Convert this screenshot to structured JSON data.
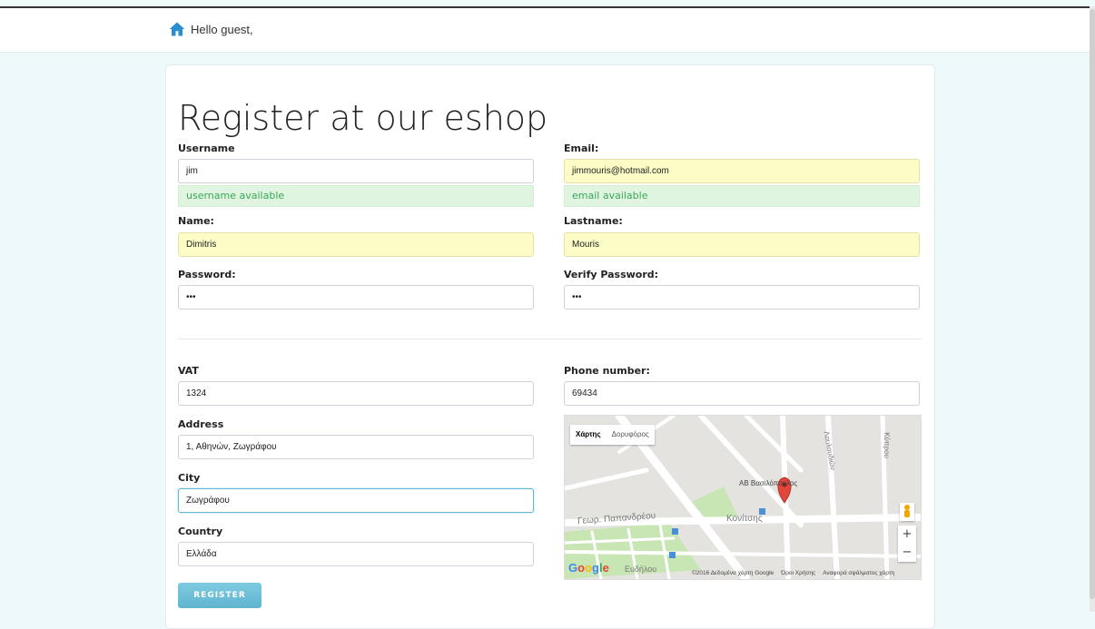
{
  "header": {
    "greeting": "Hello guest,"
  },
  "title": "Register at our eshop",
  "form": {
    "username": {
      "label": "Username",
      "value": "jim",
      "status": "username available"
    },
    "email": {
      "label": "Email:",
      "value": "jimmouris@hotmail.com",
      "status": "email available"
    },
    "name": {
      "label": "Name:",
      "value": "Dimitris"
    },
    "lastname": {
      "label": "Lastname:",
      "value": "Mouris"
    },
    "password": {
      "label": "Password:",
      "value": "•••"
    },
    "verify_password": {
      "label": "Verify Password:",
      "value": "•••"
    },
    "vat": {
      "label": "VAT",
      "value": "1324"
    },
    "phone": {
      "label": "Phone number:",
      "value": "69434"
    },
    "address": {
      "label": "Address",
      "value": "1, Αθηνών, Ζωγράφου"
    },
    "city": {
      "label": "City",
      "value": "Ζωγράφου"
    },
    "country": {
      "label": "Country",
      "value": "Ελλάδα"
    },
    "submit_label": "REGISTER"
  },
  "map": {
    "type_map": "Χάρτης",
    "type_satellite": "Δορυφόρος",
    "poi_label": "ΑΒ Βασιλόπουλος",
    "streets": [
      "Γεωρ. Παπανδρέου",
      "Κονίτσης",
      "Ευδήλου",
      "Κύπρου",
      "Λουλουδιών"
    ],
    "zoom_in": "+",
    "zoom_out": "−",
    "logo": "Google",
    "copyright": "©2016 Δεδομένα χάρτη Google",
    "terms": "Όροι Χρήσης",
    "report": "Αναφορά σφάλματος χάρτη",
    "colors": {
      "park": "#c8e6b4",
      "road": "#ffffff",
      "marker": "#e0463a"
    }
  },
  "icons": {
    "home": "home-icon",
    "marker": "map-marker-icon",
    "pegman": "pegman-icon"
  },
  "colors": {
    "accent": "#5fb4cf",
    "available_bg": "#dff5df",
    "available_text": "#3aa85a",
    "autofill": "#fcfcc6",
    "home_icon": "#2a8fd0"
  }
}
